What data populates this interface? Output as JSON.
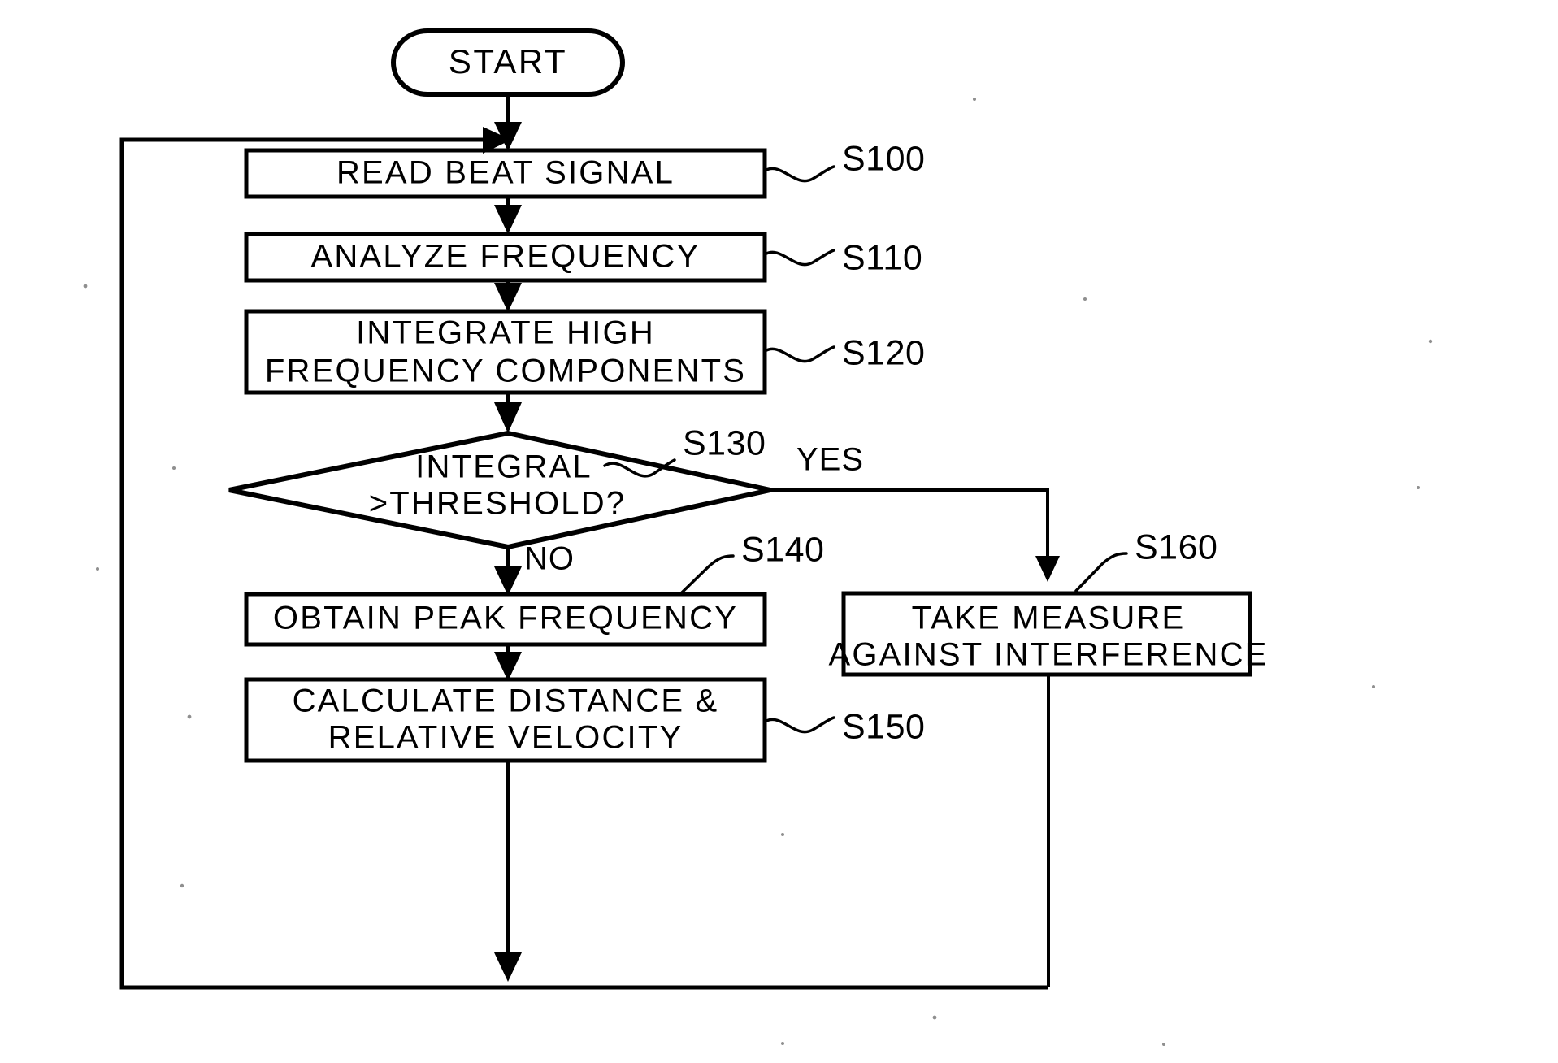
{
  "diagram": {
    "title": "Radar beat signal processing flowchart",
    "background_color": "#ffffff",
    "line_color": "#000000"
  },
  "terminal": {
    "start_label": "START"
  },
  "nodes": [
    {
      "id": "s100",
      "type": "process",
      "lines": [
        "READ BEAT SIGNAL"
      ],
      "step_label": "S100"
    },
    {
      "id": "s110",
      "type": "process",
      "lines": [
        "ANALYZE FREQUENCY"
      ],
      "step_label": "S110"
    },
    {
      "id": "s120",
      "type": "process",
      "lines": [
        "INTEGRATE HIGH",
        "FREQUENCY COMPONENTS"
      ],
      "step_label": "S120"
    },
    {
      "id": "s130",
      "type": "decision",
      "lines": [
        "INTEGRAL",
        ">THRESHOLD?"
      ],
      "step_label": "S130"
    },
    {
      "id": "s140",
      "type": "process",
      "lines": [
        "OBTAIN PEAK FREQUENCY"
      ],
      "step_label": "S140"
    },
    {
      "id": "s150",
      "type": "process",
      "lines": [
        "CALCULATE DISTANCE &",
        "RELATIVE VELOCITY"
      ],
      "step_label": "S150"
    },
    {
      "id": "s160",
      "type": "process",
      "lines": [
        "TAKE MEASURE",
        "AGAINST INTERFERENCE"
      ],
      "step_label": "S160"
    }
  ],
  "branches": {
    "yes_label": "YES",
    "no_label": "NO"
  },
  "text": {
    "start": "START",
    "s100_line1": "READ BEAT SIGNAL",
    "s110_line1": "ANALYZE FREQUENCY",
    "s120_line1": "INTEGRATE HIGH",
    "s120_line2": "FREQUENCY COMPONENTS",
    "s130_line1": "INTEGRAL",
    "s130_line2": ">THRESHOLD?",
    "s140_line1": "OBTAIN PEAK FREQUENCY",
    "s150_line1": "CALCULATE DISTANCE &",
    "s150_line2": "RELATIVE VELOCITY",
    "s160_line1": "TAKE MEASURE",
    "s160_line2": "AGAINST INTERFERENCE",
    "label_s100": "S100",
    "label_s110": "S110",
    "label_s120": "S120",
    "label_s130": "S130",
    "label_s140": "S140",
    "label_s150": "S150",
    "label_s160": "S160",
    "yes": "YES",
    "no": "NO"
  }
}
